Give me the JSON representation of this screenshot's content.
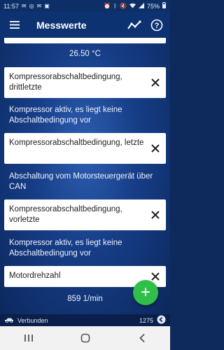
{
  "status_bar": {
    "time": "11:57",
    "battery": "75%",
    "left_icons": [
      "mail-icon",
      "whatsapp-icon",
      "email-icon",
      "image-icon"
    ],
    "right_icons": [
      "alarm-icon",
      "bluetooth-icon",
      "mute-icon",
      "wifi-icon",
      "signal-icon"
    ]
  },
  "app_bar": {
    "title": "Messwerte",
    "menu_icon": "hamburger-menu-icon",
    "chart_icon": "line-chart-icon",
    "help_icon": "help-icon"
  },
  "top_value": "26.50 °C",
  "items": [
    {
      "label": "Kompressorabschaltbedingung, drittletzte",
      "value": "Kompressor aktiv, es liegt keine Abschaltbedingung vor"
    },
    {
      "label": "Kompressorabschaltbedingung, letzte",
      "value": "Abschaltung vom Motorsteuergerät über CAN"
    },
    {
      "label": "Kompressorabschaltbedingung, vorletzte",
      "value": "Kompressor aktiv, es liegt keine Abschaltbedingung vor"
    },
    {
      "label": "Motordrehzahl",
      "value": "859 1/min"
    }
  ],
  "fab": {
    "label": "+",
    "icon": "add-icon"
  },
  "bottom_bar": {
    "connection_status": "Verbunden",
    "count": "1275",
    "car_icon": "car-icon",
    "back_icon": "back-circle-icon"
  },
  "nav_bar": {
    "icons": [
      "recent-apps-icon",
      "home-icon",
      "back-icon"
    ]
  },
  "colors": {
    "app_bar": "#0d3272",
    "background": "#163d86",
    "fab": "#2fbf4a"
  }
}
